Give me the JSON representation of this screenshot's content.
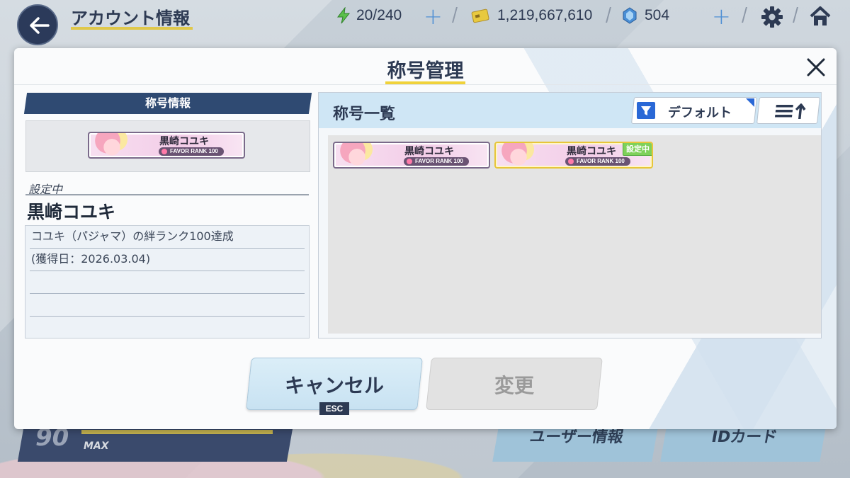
{
  "topbar": {
    "title": "アカウント情報",
    "stamina": "20/240",
    "credits": "1,219,667,610",
    "gems": "504",
    "icons": [
      "back-arrow-icon",
      "lightning-icon",
      "credit-card-icon",
      "gem-icon",
      "plus-icon",
      "gear-icon",
      "home-icon"
    ]
  },
  "background": {
    "level": "90",
    "level_max": "MAX",
    "user_info_button": "ユーザー情報",
    "id_card_button": "IDカード"
  },
  "modal": {
    "title": "称号管理",
    "info_header": "称号情報",
    "status_label": "設定中",
    "current_title": "黒崎コユキ",
    "description": [
      "コユキ（パジャマ）の絆ランク100達成",
      "(獲得日：2026.03.04)",
      "",
      ""
    ],
    "list_title": "称号一覧",
    "filter_label": "デフォルト",
    "cancel_label": "キャンセル",
    "esc_label": "ESC",
    "change_label": "変更"
  },
  "preview_plate": {
    "name": "黒崎コユキ",
    "rank": "FAVOR RANK 100"
  },
  "titles": [
    {
      "name": "黒崎コユキ",
      "rank": "FAVOR RANK 100",
      "equipped": false
    },
    {
      "name": "黒崎コユキ",
      "rank": "FAVOR RANK 100",
      "equipped": true,
      "badge": "設定中"
    }
  ],
  "colors": {
    "accent_yellow": "#f0d23a",
    "navy": "#2d3a53",
    "panel_blue": "#cfe6f5",
    "filter_blue": "#2a68d6"
  }
}
